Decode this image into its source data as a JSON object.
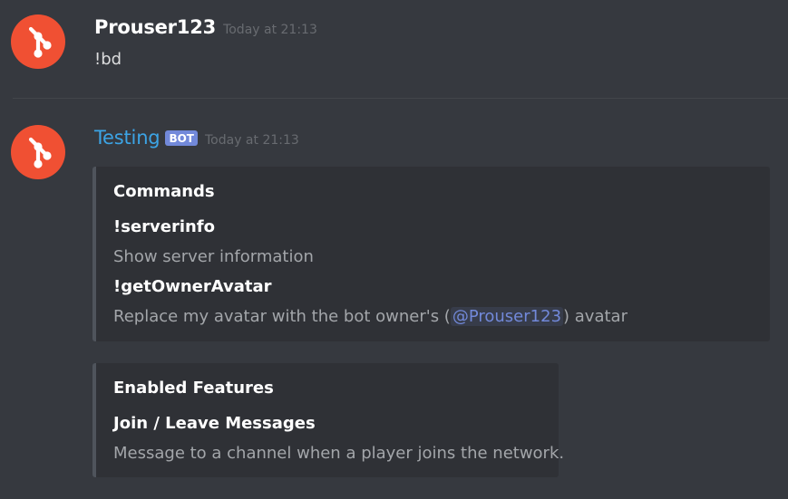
{
  "messages": [
    {
      "author": "Prouser123",
      "timestamp": "Today at 21:13",
      "content": "!bd",
      "avatar_icon": "git-logo-icon"
    },
    {
      "author": "Testing",
      "bot_tag": "BOT",
      "timestamp": "Today at 21:13",
      "avatar_icon": "git-logo-icon",
      "embeds": [
        {
          "title": "Commands",
          "fields": [
            {
              "name": "!serverinfo",
              "value": "Show server information"
            },
            {
              "name": "!getOwnerAvatar",
              "value_prefix": "Replace my avatar with the bot owner's (",
              "mention": "@Prouser123",
              "value_suffix": ") avatar"
            }
          ]
        },
        {
          "title": "Enabled Features",
          "fields": [
            {
              "name": "Join / Leave Messages",
              "value": "Message to a channel when a player joins the network."
            }
          ]
        }
      ]
    }
  ],
  "colors": {
    "background": "#36393f",
    "embed_background": "#2f3136",
    "embed_border": "#4f545c",
    "bot_name": "#3ca4e5",
    "bot_tag": "#7289da",
    "mention": "#7289da",
    "avatar": "#f05033"
  }
}
